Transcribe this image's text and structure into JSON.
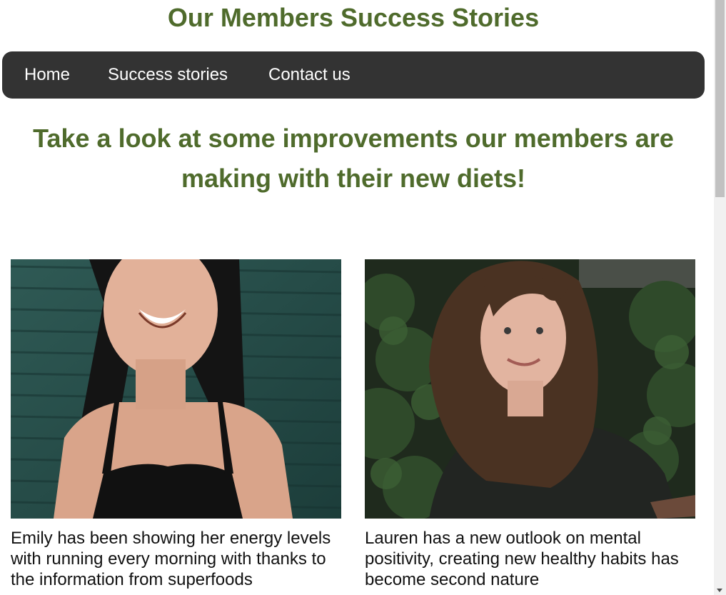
{
  "header": {
    "title": "Our Members Success Stories"
  },
  "nav": {
    "items": [
      {
        "label": "Home"
      },
      {
        "label": "Success stories"
      },
      {
        "label": "Contact us"
      }
    ]
  },
  "main": {
    "headline": "Take a look at some improvements our members are making with their new diets!",
    "stories": [
      {
        "caption": "Emily has been showing her energy levels with running every morning with thanks to the information from superfoods"
      },
      {
        "caption": "Lauren has a new outlook on mental positivity, creating new healthy habits has become second nature"
      }
    ]
  },
  "colors": {
    "title": "#4f6b2c",
    "nav_background": "#333333",
    "nav_text": "#ffffff"
  }
}
